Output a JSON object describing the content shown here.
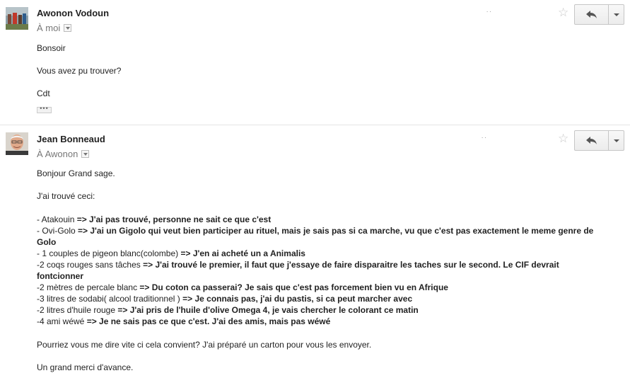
{
  "messages": [
    {
      "sender": "Awonon Vodoun",
      "to": "À moi",
      "date": ".  .",
      "body": [
        "Bonsoir",
        "Vous avez pu trouver?",
        "Cdt"
      ],
      "quoted_toggle": "•••"
    },
    {
      "sender": "Jean Bonneaud",
      "to": "À Awonon",
      "date": ".  .",
      "greeting": "Bonjour Grand sage.",
      "intro": "J'ai trouvé ceci:",
      "items": [
        {
          "item": "-  Atakouin ",
          "reply": "=> J'ai pas trouvé, personne ne sait ce que c'est"
        },
        {
          "item": "-  Ovi-Golo ",
          "reply": "=> J'ai un Gigolo qui veut bien participer au rituel, mais je sais pas si ca marche, vu que c'est pas exactement le meme genre de Golo"
        },
        {
          "item": "- 1 couples de pigeon blanc(colombe) ",
          "reply": "=> J'en ai acheté un a Animalis"
        },
        {
          "item": "-2 coqs rouges sans tâches ",
          "reply": "=> J'ai trouvé le premier, il faut que j'essaye de faire disparaitre les taches sur le second. Le CIF devrait fontcionner"
        },
        {
          "item": "-2 mètres de percale blanc ",
          "reply": "=> Du coton ca passerai? Je sais que c'est pas forcement bien vu en Afrique"
        },
        {
          "item": "-3 litres de sodabi( alcool traditionnel ) ",
          "reply": "=> Je connais pas, j'ai du pastis, si ca peut marcher avec"
        },
        {
          "item": "-2 litres d'huile rouge ",
          "reply": "=> J'ai pris de l'huile d'olive Omega 4, je vais chercher le colorant ce matin"
        },
        {
          "item": "-4 ami wéwé ",
          "reply": "=> Je ne sais pas ce que c'est. J'ai des amis, mais pas wéwé"
        }
      ],
      "closing": [
        "Pourriez vous me dire vite ci cela convient? J'ai préparé un carton pour vous les envoyer.",
        "Un grand merci d'avance."
      ]
    }
  ],
  "icons": {
    "star": "star-icon",
    "reply": "reply-arrow-icon",
    "more": "chevron-down-icon"
  }
}
